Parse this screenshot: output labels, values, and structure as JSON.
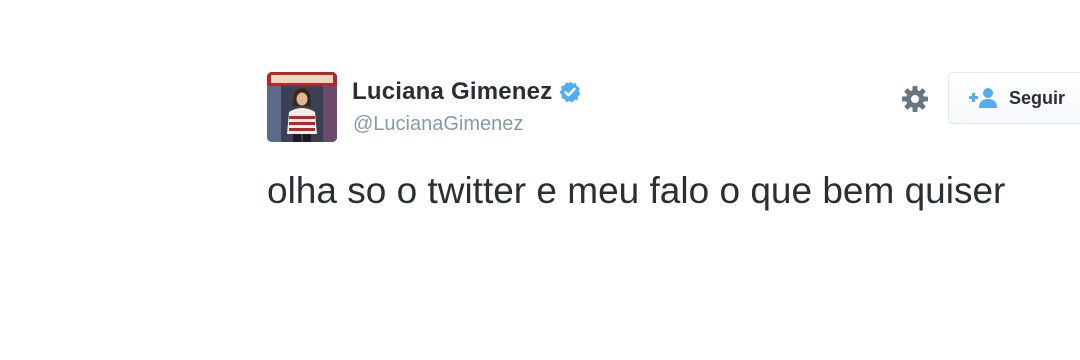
{
  "author": {
    "display_name": "Luciana Gimenez",
    "handle": "@LucianaGimenez",
    "verified": true,
    "avatar_icon": "profile-photo"
  },
  "actions": {
    "settings_icon": "gear-icon",
    "follow_label": "Seguir",
    "follow_icon": "add-user-icon"
  },
  "tweet": {
    "text": "olha so o twitter e meu falo o que bem quiser"
  },
  "colors": {
    "verified_blue": "#55acee",
    "text": "#292f33",
    "muted": "#8899a6",
    "follow_icon_blue": "#55acee",
    "gear_gray": "#66757f"
  }
}
